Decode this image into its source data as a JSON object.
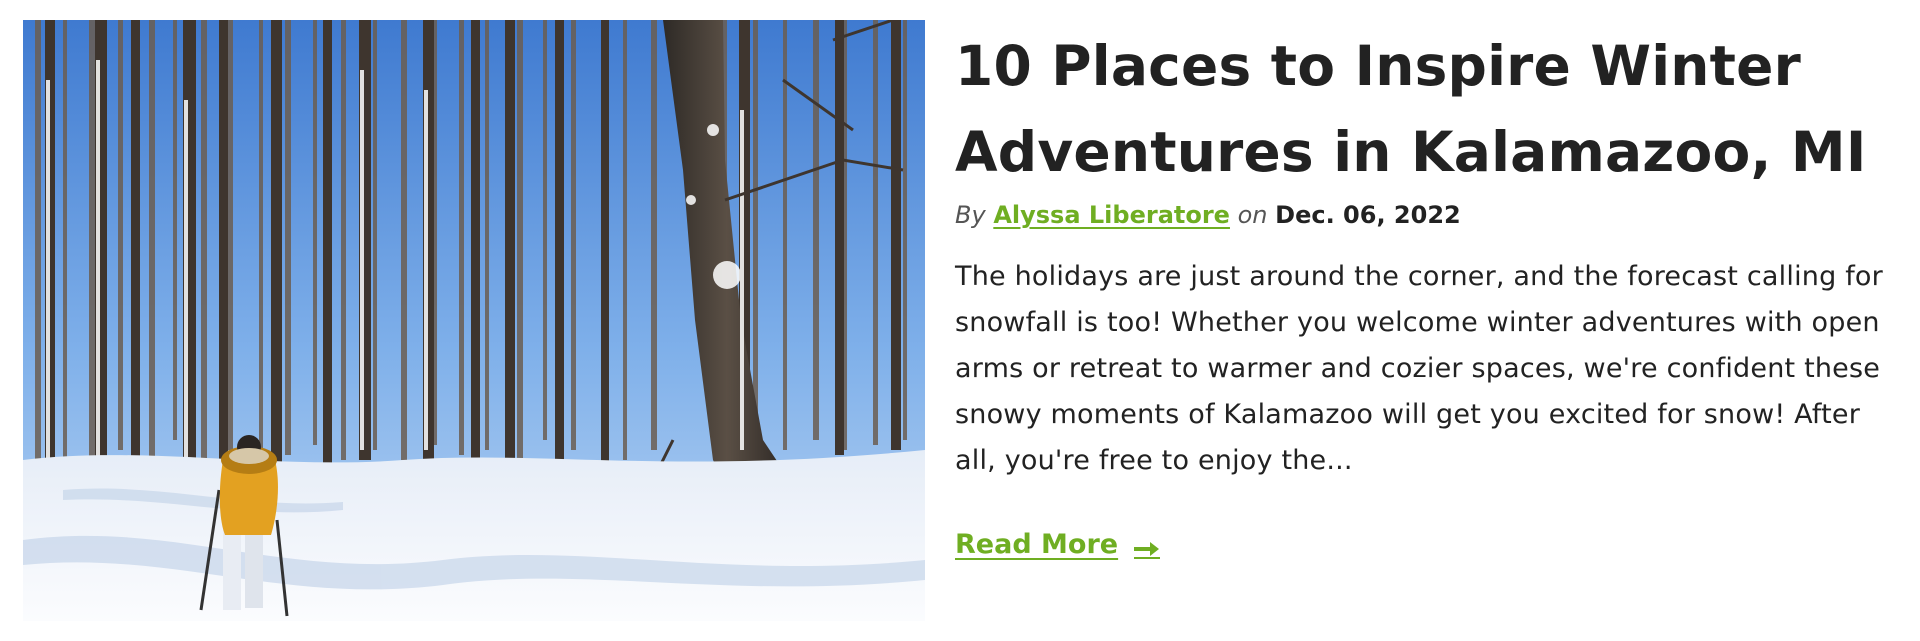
{
  "article": {
    "image_alt": "Person snowshoeing through a snowy winter forest",
    "title": "10 Places to Inspire Winter Adventures in Kalamazoo, MI",
    "byline_by": "By",
    "author": "Alyssa Liberatore",
    "byline_on": "on",
    "date": "Dec. 06, 2022",
    "excerpt": "The holidays are just around the corner, and the forecast calling for snowfall is too! Whether you welcome winter adventures with open arms or retreat to warmer and cozier spaces, we're confident these snowy moments of Kalamazoo will get you excited for snow! After all, you're free to enjoy the...",
    "read_more_label": "Read More",
    "read_more_icon": "arrow-right-icon"
  },
  "colors": {
    "accent_green": "#6fae22",
    "text": "#222222",
    "muted": "#555555",
    "sky": "#5b8fd6",
    "snow": "#f4f7fb",
    "jacket": "#e3a121"
  }
}
